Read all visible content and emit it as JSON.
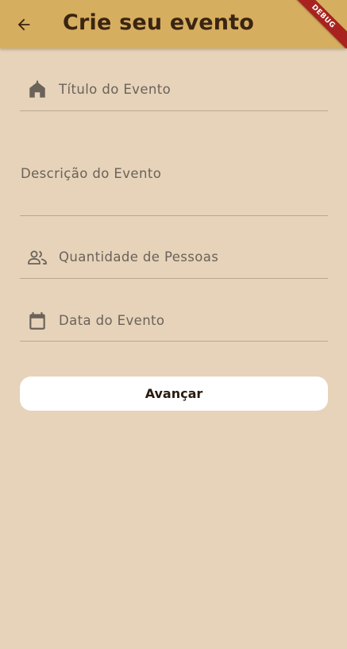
{
  "app_bar": {
    "title": "Crie seu evento",
    "back_icon": "arrow-left-icon",
    "debug_banner": "DEBUG"
  },
  "form": {
    "titulo": {
      "placeholder": "Título do Evento",
      "icon": "home-icon"
    },
    "descricao": {
      "placeholder": "Descrição do Evento"
    },
    "quantidade": {
      "placeholder": "Quantidade de Pessoas",
      "icon": "people-icon"
    },
    "data": {
      "placeholder": "Data do Evento",
      "icon": "calendar-icon"
    }
  },
  "actions": {
    "next_label": "Avançar"
  },
  "colors": {
    "app_bar": "#D6AE5F",
    "background": "#E6D3BA",
    "title": "#3A2412",
    "button_bg": "#FFFFFF",
    "debug_banner": "#A8231F"
  }
}
